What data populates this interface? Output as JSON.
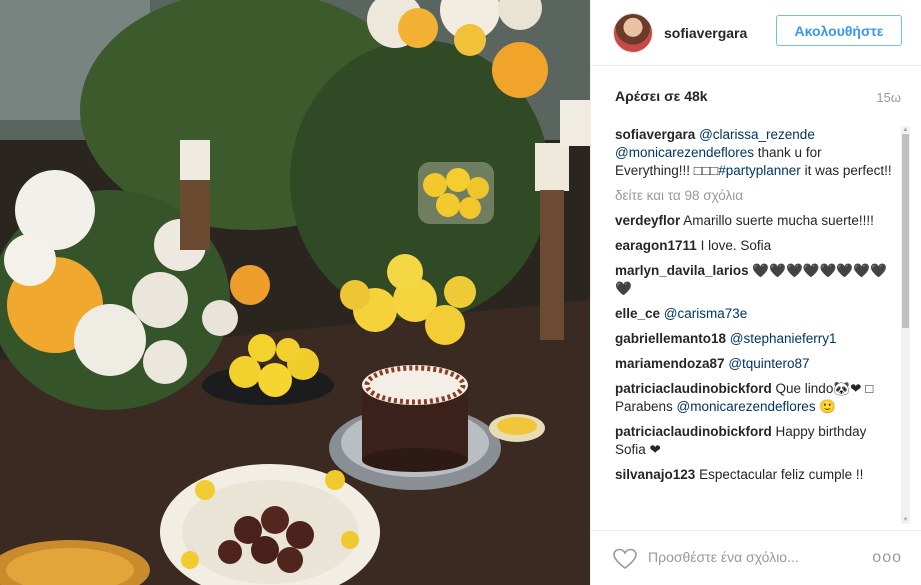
{
  "post": {
    "username": "sofiavergara",
    "follow_label": "Ακολουθήστε",
    "likes": "Αρέσει σε 48k",
    "time": "15ω",
    "caption": {
      "author": "sofiavergara",
      "mention1": "@clarissa_rezende",
      "mention2": "@monicarezendeflores",
      "text1": " thank u for Everything!!! □□□",
      "hashtag": "#partyplanner",
      "text2": " it was perfect!!"
    },
    "view_all": "δείτε και τα 98 σχόλια",
    "comments": [
      {
        "author": "verdeyflor",
        "text": " Amarillo suerte mucha suerte!!!!"
      },
      {
        "author": "earagon1711",
        "text": " I love. Sofia"
      },
      {
        "author": "marlyn_davila_larios",
        "text": " 🖤🖤🖤🖤🖤🖤🖤🖤🖤"
      },
      {
        "author": "elle_ce",
        "mention": " @carisma73e"
      },
      {
        "author": "gabriellemanto18",
        "mention": " @stephanieferry1"
      },
      {
        "author": "mariamendoza87",
        "mention": " @tquintero87"
      },
      {
        "author": "patriciaclaudinobickford",
        "text": " Que lindo🐼❤ □ Parabens ",
        "mention": "@monicarezendeflores",
        "text_after": " 🙂"
      },
      {
        "author": "patriciaclaudinobickford",
        "text": " Happy birthday Sofia ❤"
      },
      {
        "author": "silvanajo123",
        "text": " Espectacular feliz cumple !!"
      }
    ],
    "add_comment_placeholder": "Προσθέστε ένα σχόλιο...",
    "more_options": "ooo"
  },
  "icons": {
    "heart": "heart-outline-icon",
    "avatar": "profile-avatar"
  }
}
